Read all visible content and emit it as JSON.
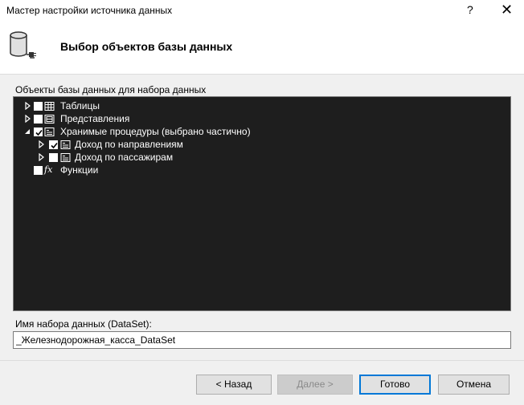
{
  "window": {
    "title": "Мастер настройки источника данных",
    "help_glyph": "?",
    "close_glyph": "✕"
  },
  "header": {
    "title": "Выбор объектов базы данных",
    "icon": "database-plug-icon"
  },
  "tree": {
    "label": "Объекты базы данных для набора данных",
    "items": [
      {
        "label": "Таблицы",
        "checked": false,
        "expanded": false,
        "icon": "table-icon"
      },
      {
        "label": "Представления",
        "checked": false,
        "expanded": false,
        "icon": "view-icon"
      },
      {
        "label": "Хранимые процедуры (выбрано частично)",
        "checked": true,
        "expanded": true,
        "icon": "stored-procedure-icon",
        "children": [
          {
            "label": "Доход по направлениям",
            "checked": true,
            "expanded": false,
            "icon": "stored-procedure-icon"
          },
          {
            "label": "Доход по пассажирам",
            "checked": false,
            "expanded": false,
            "icon": "stored-procedure-icon"
          }
        ]
      },
      {
        "label": "Функции",
        "checked": false,
        "icon": "function-icon",
        "icon_text": "fx"
      }
    ]
  },
  "dataset": {
    "label": "Имя набора данных (DataSet):",
    "value": "_Железнодорожная_касса_DataSet"
  },
  "buttons": {
    "back": "< Назад",
    "next": "Далее >",
    "finish": "Готово",
    "cancel": "Отмена"
  },
  "colors": {
    "tree_background": "#1e1e1e",
    "default_button_border": "#0078d7"
  }
}
